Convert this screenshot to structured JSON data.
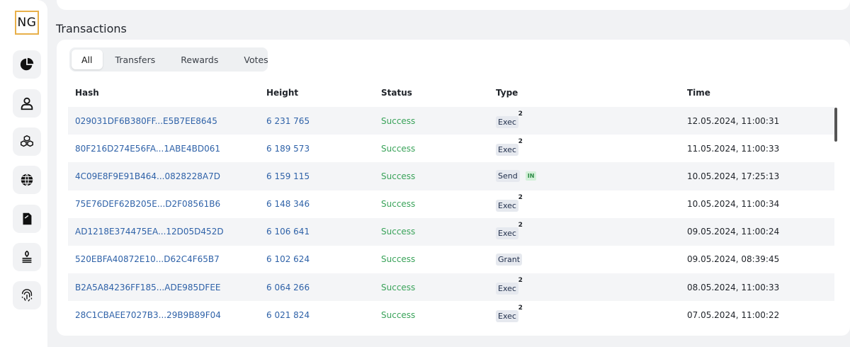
{
  "app": {
    "logo_text": "NG"
  },
  "sidebar": {
    "items": [
      {
        "icon": "pie-chart-icon"
      },
      {
        "icon": "user-icon"
      },
      {
        "icon": "cubes-icon"
      },
      {
        "icon": "globe-icon"
      },
      {
        "icon": "document-icon"
      },
      {
        "icon": "stack-icon"
      },
      {
        "icon": "fingerprint-icon"
      }
    ]
  },
  "transactions": {
    "title": "Transactions",
    "tabs": [
      {
        "label": "All",
        "active": true
      },
      {
        "label": "Transfers",
        "active": false
      },
      {
        "label": "Rewards",
        "active": false
      },
      {
        "label": "Votes",
        "active": false
      }
    ],
    "columns": {
      "hash": "Hash",
      "height": "Height",
      "status": "Status",
      "type": "Type",
      "time": "Time"
    },
    "rows": [
      {
        "hash": "029031DF6B380FF...E5B7EE8645",
        "height": "6 231 765",
        "status": "Success",
        "type": "Exec",
        "count": "2",
        "time": "12.05.2024, 11:00:31"
      },
      {
        "hash": "80F216D274E56FA...1ABE4BD061",
        "height": "6 189 573",
        "status": "Success",
        "type": "Exec",
        "count": "2",
        "time": "11.05.2024, 11:00:33"
      },
      {
        "hash": "4C09E8F9E91B464...0828228A7D",
        "height": "6 159 115",
        "status": "Success",
        "type": "Send",
        "direction": "IN",
        "time": "10.05.2024, 17:25:13"
      },
      {
        "hash": "75E76DEF62B205E...D2F08561B6",
        "height": "6 148 346",
        "status": "Success",
        "type": "Exec",
        "count": "2",
        "time": "10.05.2024, 11:00:34"
      },
      {
        "hash": "AD1218E374475EA...12D05D452D",
        "height": "6 106 641",
        "status": "Success",
        "type": "Exec",
        "count": "2",
        "time": "09.05.2024, 11:00:24"
      },
      {
        "hash": "520EBFA40872E10...D62C4F65B7",
        "height": "6 102 624",
        "status": "Success",
        "type": "Grant",
        "time": "09.05.2024, 08:39:45"
      },
      {
        "hash": "B2A5A84236FF185...ADE985DFEE",
        "height": "6 064 266",
        "status": "Success",
        "type": "Exec",
        "count": "2",
        "time": "08.05.2024, 11:00:33"
      },
      {
        "hash": "28C1CBAEE7027B3...29B9B89F04",
        "height": "6 021 824",
        "status": "Success",
        "type": "Exec",
        "count": "2",
        "time": "07.05.2024, 11:00:22"
      }
    ]
  }
}
